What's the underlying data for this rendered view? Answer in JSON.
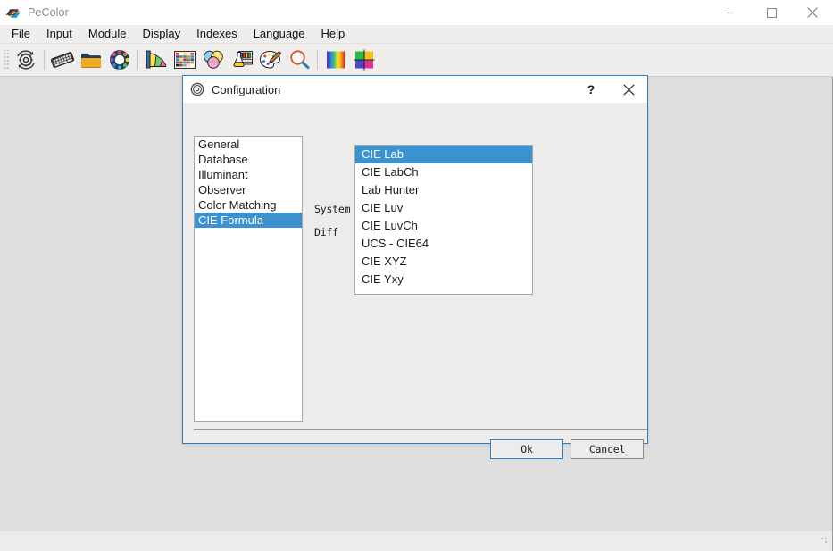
{
  "app": {
    "title": "PeColor",
    "logo_icon": "pecolor-diamond-logo-icon",
    "window_controls": [
      {
        "name": "minimize",
        "icon": "minimize-icon"
      },
      {
        "name": "maximize",
        "icon": "maximize-icon"
      },
      {
        "name": "close",
        "icon": "close-icon"
      }
    ]
  },
  "menu": {
    "items": [
      {
        "label": "File"
      },
      {
        "label": "Input"
      },
      {
        "label": "Module"
      },
      {
        "label": "Display"
      },
      {
        "label": "Indexes"
      },
      {
        "label": "Language"
      },
      {
        "label": "Help"
      }
    ]
  },
  "toolbar": {
    "buttons": [
      {
        "icon": "gear-refresh-icon"
      },
      {
        "separator": true
      },
      {
        "icon": "keyboard-icon"
      },
      {
        "icon": "folder-icon"
      },
      {
        "icon": "color-wheel-icon"
      },
      {
        "separator": true
      },
      {
        "icon": "color-fan-deck-icon"
      },
      {
        "icon": "color-chart-grid-icon"
      },
      {
        "icon": "cmy-circles-icon"
      },
      {
        "icon": "lab-flask-icon"
      },
      {
        "icon": "paint-palette-icon"
      },
      {
        "icon": "magnifier-icon"
      },
      {
        "separator": true
      },
      {
        "icon": "spectrum-bars-icon"
      },
      {
        "icon": "color-quadrant-icon"
      }
    ]
  },
  "status_bar": {
    "text": "",
    "grip_icon": "resize-grip-icon"
  },
  "dialog": {
    "title": "Configuration",
    "icon": "gear-icon",
    "help_label": "?",
    "close_icon": "close-icon",
    "categories": [
      {
        "label": "General",
        "selected": false
      },
      {
        "label": "Database",
        "selected": false
      },
      {
        "label": "Illuminant",
        "selected": false
      },
      {
        "label": "Observer",
        "selected": false
      },
      {
        "label": "Color Matching",
        "selected": false
      },
      {
        "label": "CIE Formula",
        "selected": true
      }
    ],
    "fields": {
      "system_label": "System",
      "diff_label": "Diff"
    },
    "system_options": [
      {
        "label": "CIE Lab",
        "selected": true
      },
      {
        "label": "CIE LabCh",
        "selected": false
      },
      {
        "label": "Lab Hunter",
        "selected": false
      },
      {
        "label": "CIE Luv",
        "selected": false
      },
      {
        "label": "CIE LuvCh",
        "selected": false
      },
      {
        "label": "UCS - CIE64",
        "selected": false
      },
      {
        "label": "CIE XYZ",
        "selected": false
      },
      {
        "label": "CIE Yxy",
        "selected": false
      }
    ],
    "buttons": {
      "ok_label": "Ok",
      "cancel_label": "Cancel"
    }
  },
  "colors": {
    "selection_blue": "#3c92ce",
    "dialog_border": "#2b80c5",
    "dialog_bg": "#eeecea",
    "window_bg": "#dedede",
    "titlebar_bg": "#ffffff"
  }
}
